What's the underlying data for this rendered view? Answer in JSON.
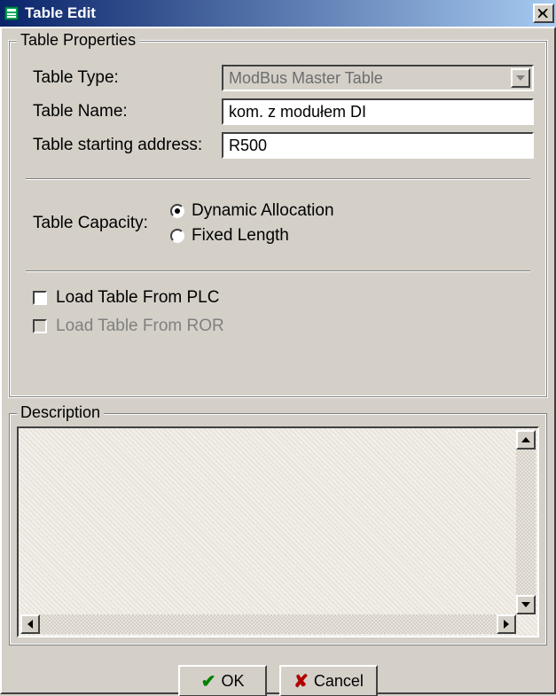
{
  "window": {
    "title": "Table Edit"
  },
  "group_properties": {
    "legend": "Table Properties",
    "type_label": "Table Type:",
    "type_value": "ModBus Master Table",
    "name_label": "Table Name:",
    "name_value": "kom. z modułem DI",
    "addr_label": "Table starting address:",
    "addr_value": "R500",
    "capacity_label": "Table Capacity:",
    "capacity_options": {
      "dynamic": "Dynamic Allocation",
      "fixed": "Fixed Length",
      "selected": "dynamic"
    },
    "load_plc_label": "Load Table From PLC",
    "load_plc_checked": false,
    "load_ror_label": "Load Table From ROR",
    "load_ror_enabled": false,
    "load_ror_checked": false
  },
  "group_description": {
    "legend": "Description",
    "text": ""
  },
  "buttons": {
    "ok": "OK",
    "cancel": "Cancel"
  },
  "colors": {
    "face": "#d4d0c8",
    "title_left": "#0a246a",
    "title_right": "#a6caf0",
    "accent_green": "#008000",
    "accent_red": "#b00000"
  }
}
